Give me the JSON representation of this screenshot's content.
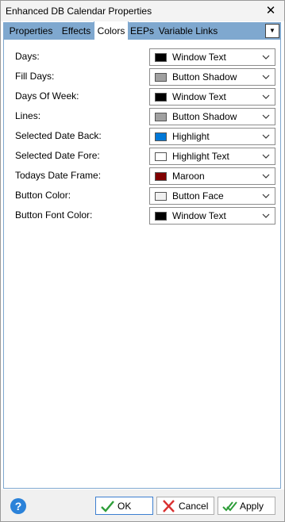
{
  "window": {
    "title": "Enhanced DB Calendar Properties",
    "close_glyph": "✕"
  },
  "tabs": [
    {
      "label": "Properties"
    },
    {
      "label": "Effects"
    },
    {
      "label": "Colors",
      "active": true
    },
    {
      "label": "EEPs"
    },
    {
      "label": "Variable Links"
    }
  ],
  "tab_menu_glyph": "▼",
  "colors": [
    {
      "label": "Days:",
      "value": "Window Text",
      "swatch": "#000000"
    },
    {
      "label": "Fill Days:",
      "value": "Button Shadow",
      "swatch": "#a0a0a0"
    },
    {
      "label": "Days Of Week:",
      "value": "Window Text",
      "swatch": "#000000"
    },
    {
      "label": "Lines:",
      "value": "Button Shadow",
      "swatch": "#a0a0a0"
    },
    {
      "label": "Selected Date Back:",
      "value": "Highlight",
      "swatch": "#0078d7"
    },
    {
      "label": "Selected Date Fore:",
      "value": "Highlight Text",
      "swatch": "#ffffff"
    },
    {
      "label": "Todays Date Frame:",
      "value": "Maroon",
      "swatch": "#800000"
    },
    {
      "label": "Button Color:",
      "value": "Button Face",
      "swatch": "#f0f0f0"
    },
    {
      "label": "Button Font Color:",
      "value": "Window Text",
      "swatch": "#000000"
    }
  ],
  "footer": {
    "help_glyph": "?",
    "ok_label": "OK",
    "cancel_label": "Cancel",
    "apply_label": "Apply"
  },
  "accent_colors": {
    "tab_bar": "#7fa8cf",
    "help": "#2b82d9",
    "ok_check": "#2e9e3a",
    "cancel_x": "#d93030"
  }
}
